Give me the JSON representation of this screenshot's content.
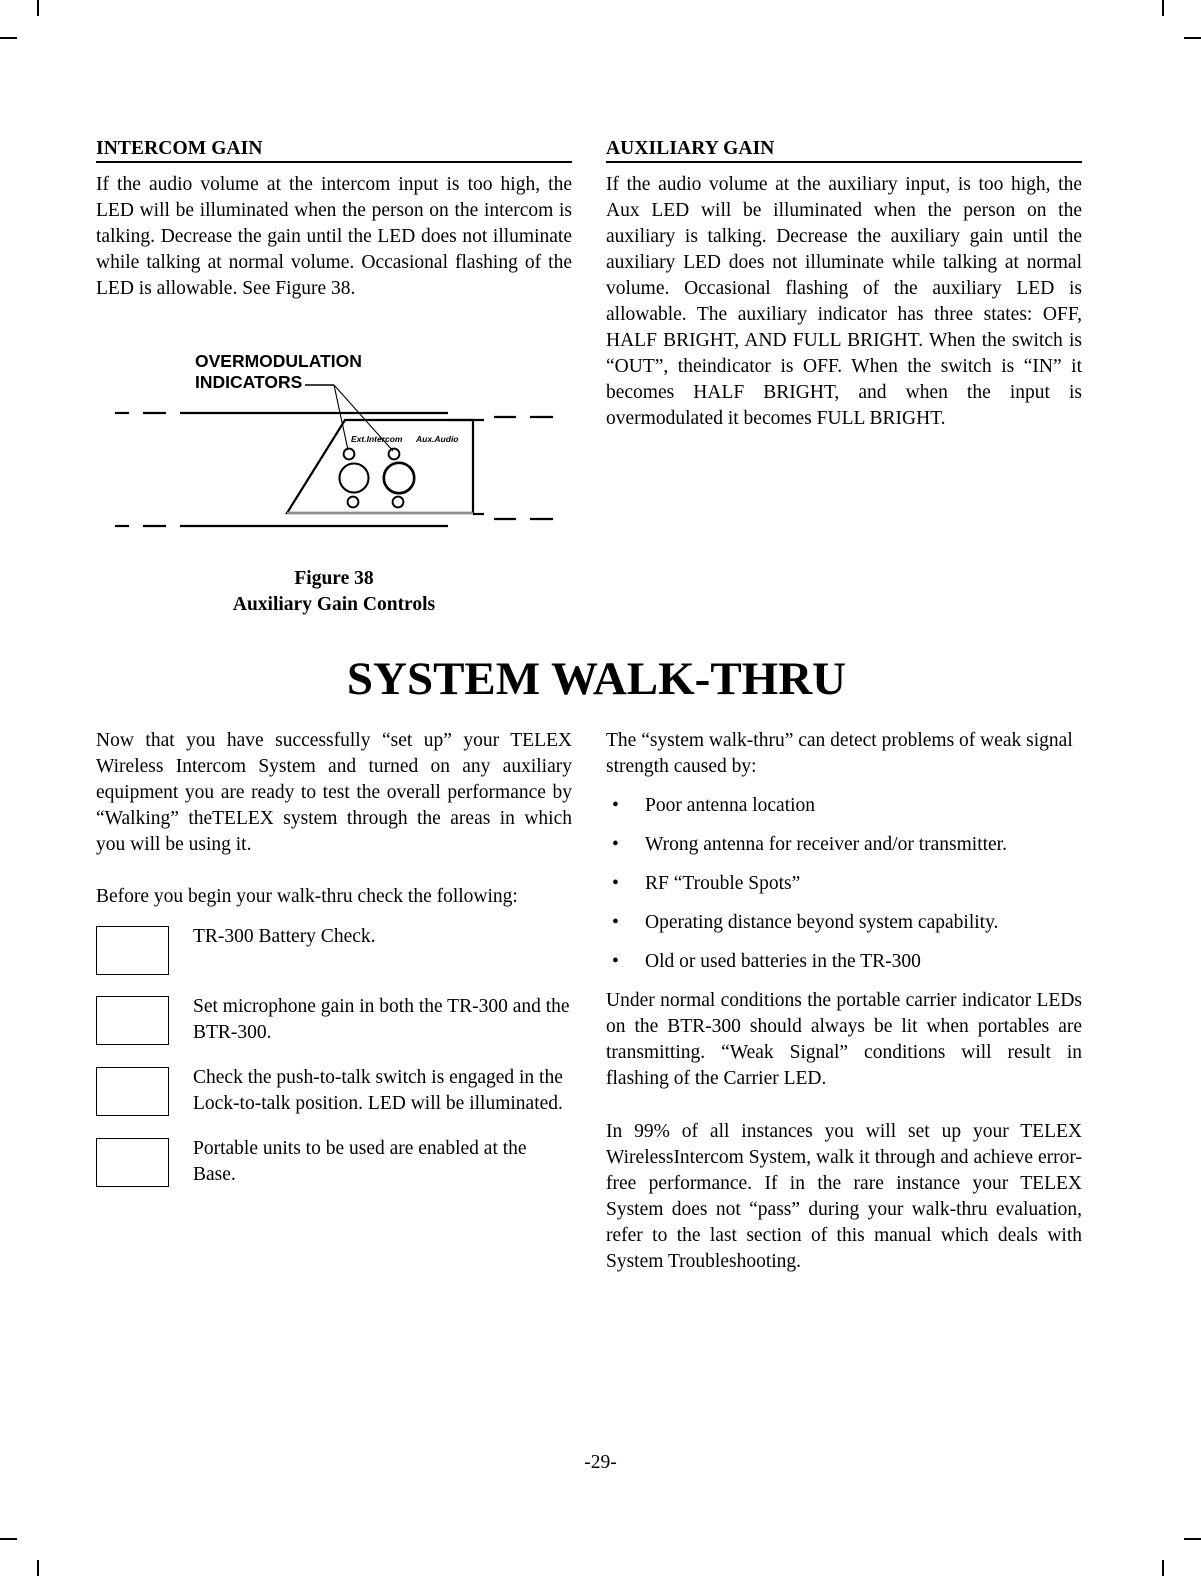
{
  "document": {
    "page_number": "-29-"
  },
  "left_column": {
    "heading": "INTERCOM GAIN",
    "paragraph": "If the audio volume at the intercom input is too high, the LED will be illuminated when the person on the intercom is talking. Decrease the gain until the LED does not illuminate while talking at normal volume. Occasional flashing of the LED is allowable. See Figure 38."
  },
  "right_column": {
    "heading": "AUXILIARY GAIN",
    "paragraph": "If the audio volume at the auxiliary input, is too high, the Aux LED will be illuminated when the person on the auxiliary is talking. Decrease the auxiliary gain until the auxiliary LED does not illuminate while talking at normal volume. Occasional flashing of the auxiliary LED is allowable. The auxiliary indicator has three states: OFF, HALF BRIGHT, AND FULL BRIGHT. When the switch is “OUT”, theindicator is OFF. When the switch is “IN” it becomes HALF BRIGHT, and when the input is overmodulated it becomes FULL BRIGHT."
  },
  "figure": {
    "callout_line1": "OVERMODULATION",
    "callout_line2": "INDICATORS",
    "panel_label_left": "Ext.Intercom",
    "panel_label_right": "Aux.Audio",
    "caption_line1": "Figure 38",
    "caption_line2": "Auxiliary Gain Controls"
  },
  "main_section": {
    "title": "SYSTEM WALK-THRU",
    "left": {
      "intro_paragraph": "Now that you have successfully “set up” your TELEX Wireless Intercom System and turned on any auxiliary equipment you are ready to test the overall performance by “Walking” theTELEX system through the areas in which you will be using it.",
      "before_paragraph": "Before you begin your walk-thru check the following:",
      "checklist": [
        "TR-300 Battery Check.",
        "Set microphone gain in both the TR-300 and the BTR-300.",
        "Check the push-to-talk switch is  engaged in the Lock-to-talk position. LED will be illuminated.",
        "Portable units to be used are enabled at the Base."
      ]
    },
    "right": {
      "detect_paragraph": "The “system walk-thru” can detect problems of weak signal strength caused by:",
      "bullet_marker": "•",
      "bullets": [
        "Poor antenna location",
        "Wrong antenna for receiver and/or transmitter.",
        "RF “Trouble Spots”",
        "Operating distance beyond system capability.",
        "Old or used batteries in the TR-300"
      ],
      "normal_conditions_paragraph": "Under normal conditions the portable carrier indicator LEDs on the BTR-300 should always be lit when portables are transmitting.  “Weak Signal” conditions will result in flashing of the Carrier LED.",
      "closing_paragraph": "In 99% of all instances you will set up your TELEX WirelessIntercom System, walk it through and achieve error-free performance.  If in the rare instance your TELEX System does not “pass” during your walk-thru evaluation, refer to the last section of this manual which deals with System Troubleshooting."
    }
  }
}
